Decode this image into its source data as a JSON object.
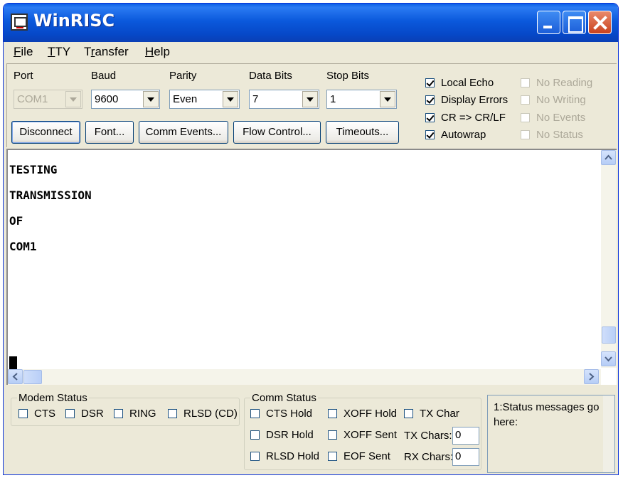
{
  "window": {
    "title": "WinRISC"
  },
  "menu": [
    {
      "label": "File",
      "hotkey": "F",
      "rest": "ile"
    },
    {
      "label": "TTY",
      "hotkey": "T",
      "rest": "TY"
    },
    {
      "label": "Transfer",
      "hotkey": "r",
      "pre": "T",
      "rest": "ansfer"
    },
    {
      "label": "Help",
      "hotkey": "H",
      "rest": "elp"
    }
  ],
  "settings": {
    "port": {
      "label": "Port",
      "value": "COM1"
    },
    "baud": {
      "label": "Baud",
      "value": "9600"
    },
    "parity": {
      "label": "Parity",
      "value": "Even"
    },
    "data_bits": {
      "label": "Data Bits",
      "value": "7"
    },
    "stop_bits": {
      "label": "Stop Bits",
      "value": "1"
    }
  },
  "buttons": {
    "disconnect": "Disconnect",
    "font": "Font...",
    "comm_events": "Comm Events...",
    "flow_control": "Flow Control...",
    "timeouts": "Timeouts..."
  },
  "options": {
    "local_echo": {
      "label": "Local Echo",
      "checked": true
    },
    "display_errors": {
      "label": "Display Errors",
      "checked": true
    },
    "cr_crlf": {
      "label": "CR => CR/LF",
      "checked": true
    },
    "autowrap": {
      "label": "Autowrap",
      "checked": true
    },
    "no_reading": {
      "label": "No Reading",
      "checked": false,
      "disabled": true
    },
    "no_writing": {
      "label": "No Writing",
      "checked": false,
      "disabled": true
    },
    "no_events": {
      "label": "No Events",
      "checked": false,
      "disabled": true
    },
    "no_status": {
      "label": "No Status",
      "checked": false,
      "disabled": true
    }
  },
  "terminal": {
    "lines": [
      "TESTING",
      "TRANSMISSION",
      "OF",
      "COM1"
    ]
  },
  "modem_status": {
    "title": "Modem Status",
    "items": [
      "CTS",
      "DSR",
      "RING",
      "RLSD (CD)"
    ]
  },
  "comm_status": {
    "title": "Comm Status",
    "cts_hold": "CTS Hold",
    "dsr_hold": "DSR Hold",
    "rlsd_hold": "RLSD Hold",
    "xoff_hold": "XOFF Hold",
    "xoff_sent": "XOFF Sent",
    "eof_sent": "EOF Sent",
    "tx_char": "TX Char",
    "tx_chars_label": "TX Chars:",
    "tx_chars_value": "0",
    "rx_chars_label": "RX Chars:",
    "rx_chars_value": "0"
  },
  "status_message": "1:Status messages go here:"
}
